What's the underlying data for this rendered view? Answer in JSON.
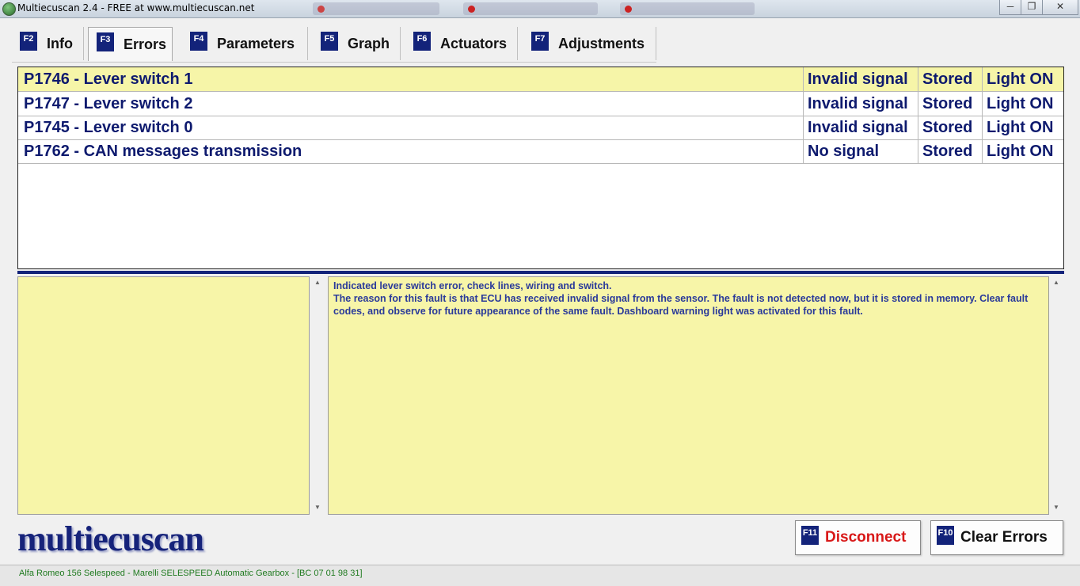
{
  "window": {
    "title": "Multiecuscan 2.4 - FREE at www.multiecuscan.net",
    "controls": [
      "─",
      "❐",
      "✕"
    ]
  },
  "tabs": [
    {
      "key": "F2",
      "label": "Info"
    },
    {
      "key": "F3",
      "label": "Errors",
      "active": true
    },
    {
      "key": "F4",
      "label": "Parameters"
    },
    {
      "key": "F5",
      "label": "Graph"
    },
    {
      "key": "F6",
      "label": "Actuators"
    },
    {
      "key": "F7",
      "label": "Adjustments"
    }
  ],
  "errors": [
    {
      "code": "P1746 - Lever switch 1",
      "signal": "Invalid signal",
      "status": "Stored",
      "light": "Light ON",
      "selected": true
    },
    {
      "code": "P1747 - Lever switch 2",
      "signal": "Invalid signal",
      "status": "Stored",
      "light": "Light ON"
    },
    {
      "code": "P1745 - Lever switch 0",
      "signal": "Invalid signal",
      "status": "Stored",
      "light": "Light ON"
    },
    {
      "code": "P1762 - CAN messages transmission",
      "signal": "No signal",
      "status": "Stored",
      "light": "Light ON"
    }
  ],
  "description": {
    "line1": "Indicated lever switch error, check lines, wiring and switch.",
    "line2": "The reason for this fault is that ECU has received invalid signal from the sensor. The fault is not detected now, but it is stored in memory. Clear fault codes, and observe for future appearance of the same fault. Dashboard warning light was activated for this fault."
  },
  "logo": "multiecuscan",
  "buttons": {
    "disconnect": {
      "key": "F11",
      "label": "Disconnect",
      "color": "#d81818"
    },
    "clear": {
      "key": "F10",
      "label": "Clear Errors",
      "color": "#111111"
    }
  },
  "status": "Alfa Romeo 156 Selespeed - Marelli SELESPEED Automatic Gearbox - [BC 07 01 98 31]",
  "colors": {
    "accent": "#13237a",
    "highlight": "#f6f5a8",
    "text": "#0e1a6e"
  }
}
